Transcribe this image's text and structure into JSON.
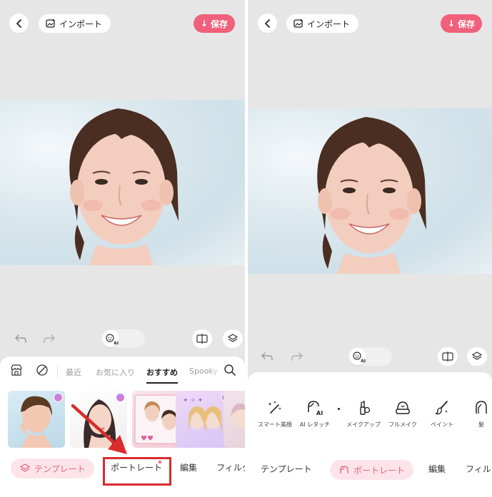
{
  "left_screen": {
    "header": {
      "import_label": "インポート",
      "save_label": "保存"
    },
    "categories": [
      "最近",
      "お気に入り",
      "おすすめ",
      "Spooky"
    ],
    "active_category": "おすすめ",
    "bottom_nav": {
      "template": "テンプレート",
      "portrait": "ポートレート",
      "edit": "編集",
      "filter": "フィルタ"
    },
    "face_ai_badge": "AI"
  },
  "right_screen": {
    "header": {
      "import_label": "インポート",
      "save_label": "保存"
    },
    "tools": [
      {
        "label": "スマート美顔",
        "icon": "magic-wand-icon"
      },
      {
        "label": "AI レタッチ",
        "icon": "ai-retouch-icon"
      },
      {
        "label": "メイクアップ",
        "icon": "lipstick-icon"
      },
      {
        "label": "フルメイク",
        "icon": "full-makeup-icon"
      },
      {
        "label": "ペイント",
        "icon": "brush-icon"
      },
      {
        "label": "髪",
        "icon": "hair-icon"
      }
    ],
    "bottom_nav": {
      "template": "テンプレート",
      "portrait": "ポートレート",
      "edit": "編集",
      "filter": "フィル"
    },
    "face_ai_badge": "AI"
  },
  "colors": {
    "accent": "#f0607a",
    "highlight": "#d92c2c",
    "pill_bg": "#fde4ea"
  }
}
